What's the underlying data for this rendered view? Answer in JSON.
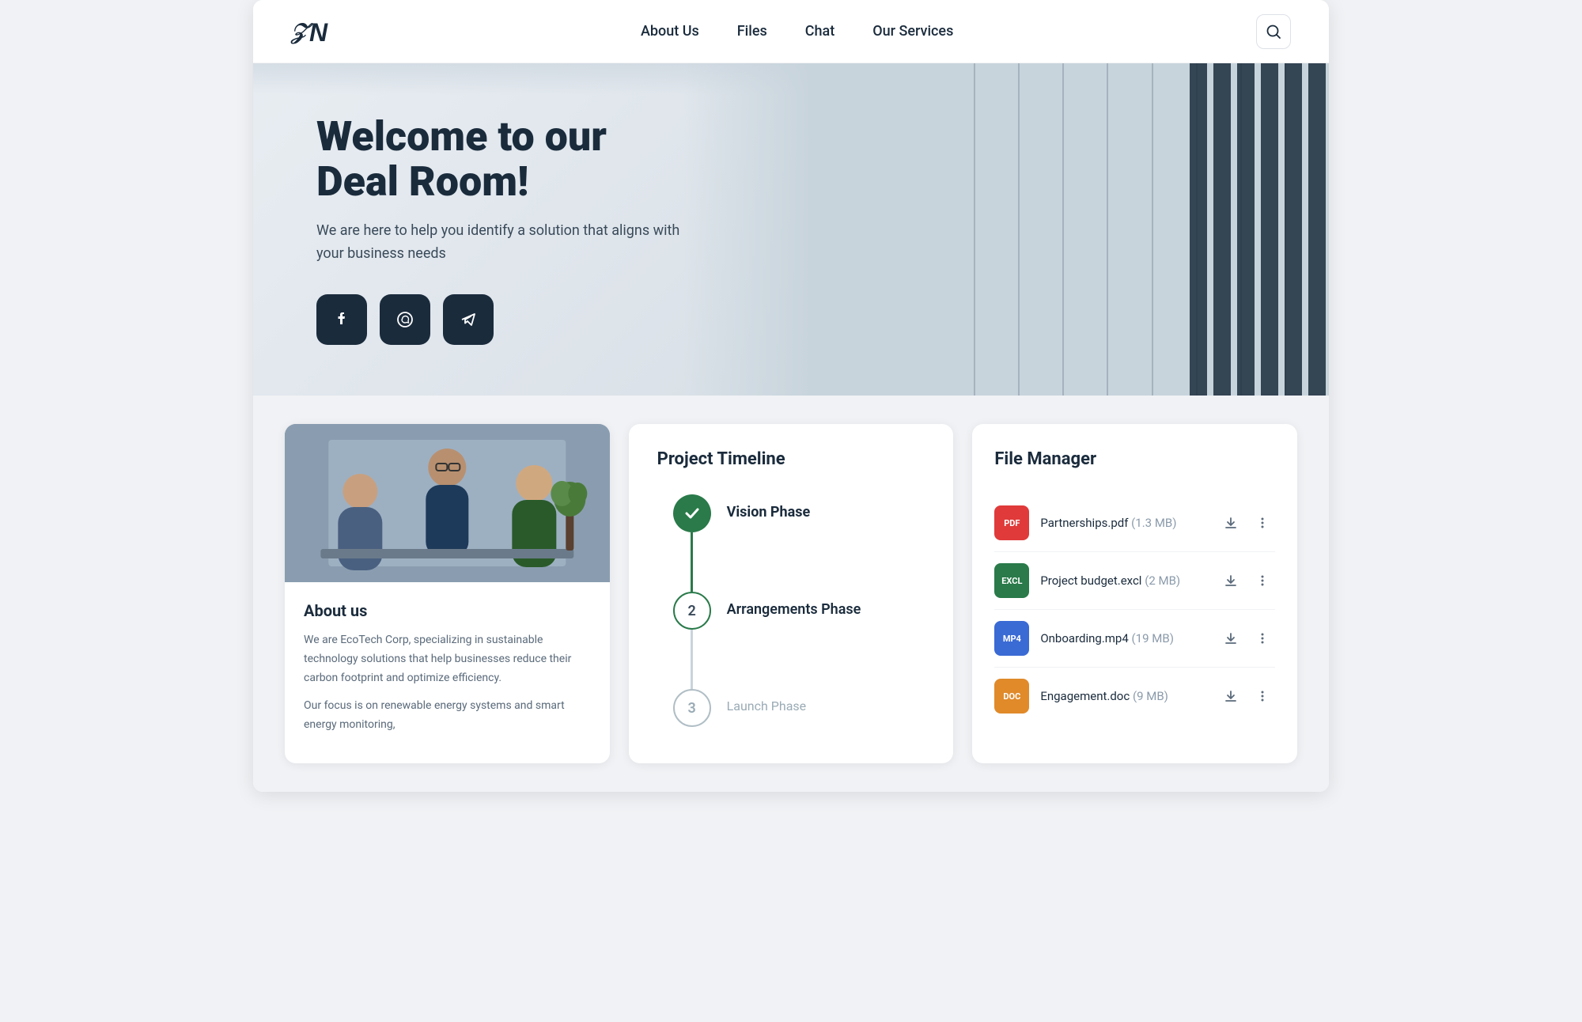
{
  "brand": {
    "logo_text": "N",
    "logo_alt": "N logo"
  },
  "nav": {
    "links": [
      {
        "label": "About Us",
        "href": "#"
      },
      {
        "label": "Files",
        "href": "#"
      },
      {
        "label": "Chat",
        "href": "#"
      },
      {
        "label": "Our Services",
        "href": "#"
      }
    ],
    "search_label": "Search"
  },
  "hero": {
    "title": "Welcome to our Deal Room!",
    "subtitle": "We are here to help you identify a solution that aligns with your business needs",
    "social_buttons": [
      {
        "label": "Facebook",
        "icon": "f"
      },
      {
        "label": "WhatsApp",
        "icon": "phone"
      },
      {
        "label": "Telegram",
        "icon": "send"
      }
    ]
  },
  "about": {
    "title": "About us",
    "paragraphs": [
      "We are EcoTech Corp, specializing in sustainable technology solutions that help businesses reduce their carbon footprint and optimize efficiency.",
      "Our focus is on renewable energy systems and smart energy monitoring,"
    ]
  },
  "timeline": {
    "title": "Project Timeline",
    "phases": [
      {
        "number": "✓",
        "label": "Vision Phase",
        "state": "completed"
      },
      {
        "number": "2",
        "label": "Arrangements Phase",
        "state": "active"
      },
      {
        "number": "3",
        "label": "Launch Phase",
        "state": "pending"
      }
    ]
  },
  "files": {
    "title": "File Manager",
    "items": [
      {
        "icon_label": "PDF",
        "icon_class": "file-icon-pdf",
        "name": "Partnerships.pdf",
        "size": "(1.3 MB)"
      },
      {
        "icon_label": "EXCL",
        "icon_class": "file-icon-excl",
        "name": "Project budget.excl",
        "size": "(2 MB)"
      },
      {
        "icon_label": "MP4",
        "icon_class": "file-icon-mp4",
        "name": "Onboarding.mp4",
        "size": "(19 MB)"
      },
      {
        "icon_label": "DOC",
        "icon_class": "file-icon-doc",
        "name": "Engagement.doc",
        "size": "(9 MB)"
      }
    ]
  }
}
